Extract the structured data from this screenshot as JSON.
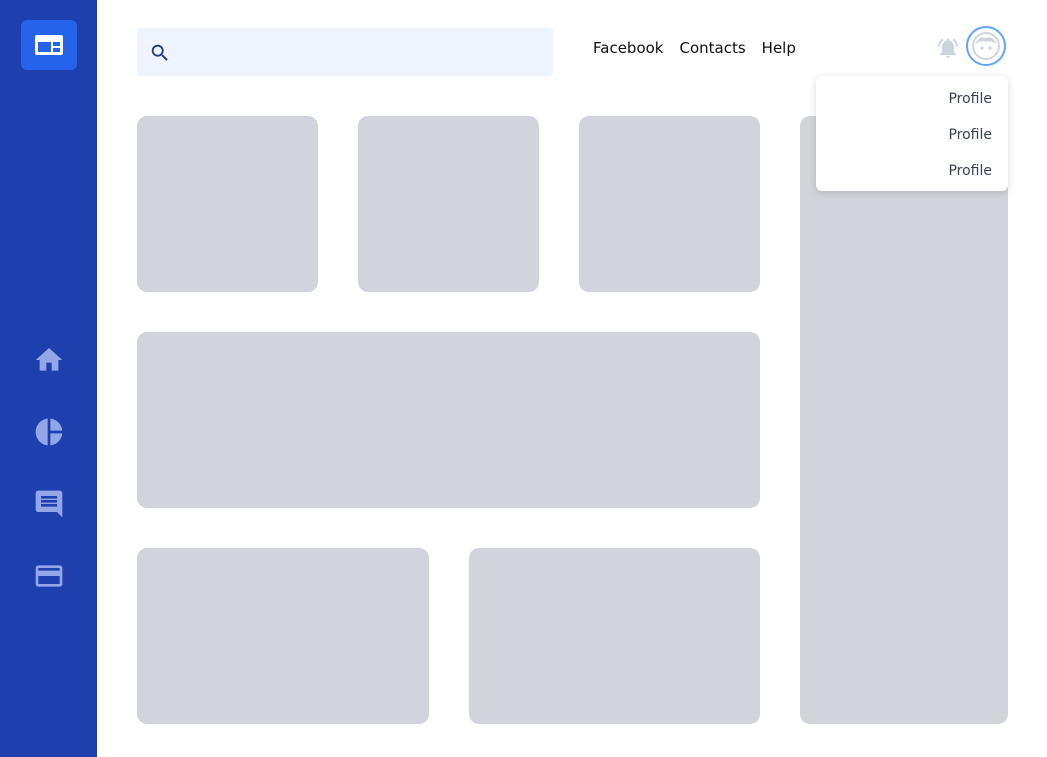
{
  "search": {
    "placeholder": "",
    "value": ""
  },
  "nav_links": [
    "Facebook",
    "Contacts",
    "Help"
  ],
  "dropdown": {
    "items": [
      "Profile",
      "Profile",
      "Profile"
    ]
  },
  "sidebar": {
    "logo_icon": "dashboard-logo-icon",
    "items": [
      {
        "icon": "home-icon"
      },
      {
        "icon": "pie-chart-icon"
      },
      {
        "icon": "chat-icon"
      },
      {
        "icon": "credit-card-icon"
      }
    ]
  },
  "colors": {
    "sidebar": "#1e40af",
    "logo_bg": "#2563eb",
    "search_bg": "#eff4ff",
    "placeholder_card": "#d1d5db",
    "avatar_ring": "#60a5fa",
    "sidebar_icon": "#93a6e6"
  }
}
